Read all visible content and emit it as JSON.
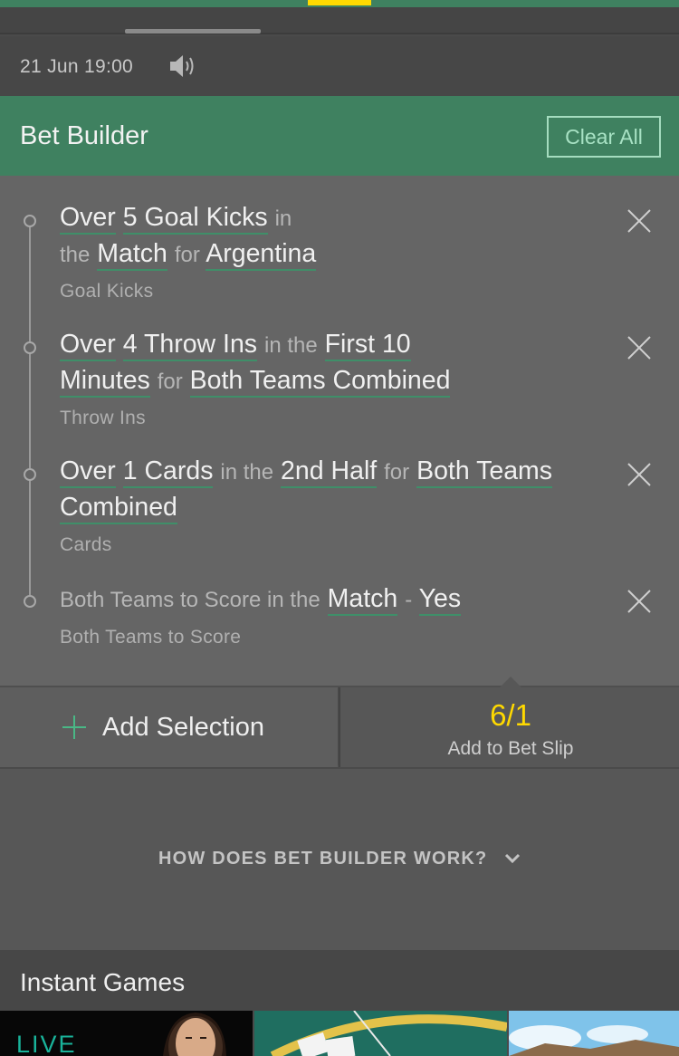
{
  "colors": {
    "brand_green": "#3f8160",
    "accent_yellow": "#ffd900",
    "link_underline": "#3f8f69"
  },
  "event": {
    "datetime": "21 Jun 19:00",
    "audio_icon": "speaker-icon"
  },
  "bet_builder": {
    "title": "Bet Builder",
    "clear_all": "Clear All",
    "selections": [
      {
        "parts": [
          "Over",
          "5 Goal Kicks",
          "in",
          "the",
          "Match",
          "for",
          "Argentina"
        ],
        "market": "Goal Kicks"
      },
      {
        "parts": [
          "Over",
          "4 Throw Ins",
          "in the",
          "First 10",
          "Minutes",
          "for",
          "Both Teams Combined"
        ],
        "market": "Throw Ins"
      },
      {
        "parts": [
          "Over",
          "1 Cards",
          "in the",
          "2nd Half",
          "for",
          "Both Teams",
          "Combined"
        ],
        "market": "Cards"
      },
      {
        "parts": [
          "Both Teams to Score in the",
          "Match",
          "-",
          "Yes"
        ],
        "market": "Both Teams to Score"
      }
    ],
    "add_selection": "Add Selection",
    "odds": "6/1",
    "add_to_bet_slip": "Add to Bet Slip",
    "how_it_works": "HOW DOES BET BUILDER WORK?"
  },
  "instant_games": {
    "title": "Instant Games",
    "tiles": [
      {
        "text": "LIVE"
      },
      {
        "text": ""
      },
      {
        "text": ""
      }
    ]
  }
}
